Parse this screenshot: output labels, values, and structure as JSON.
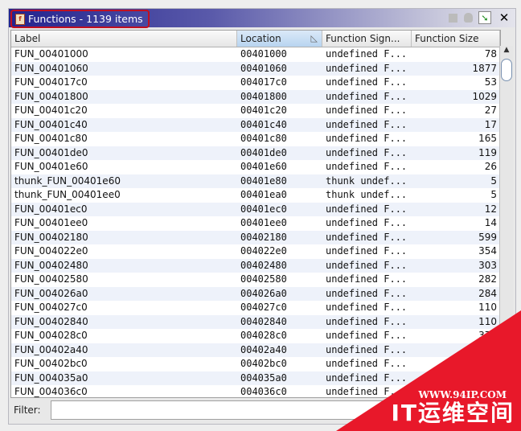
{
  "window": {
    "title": "Functions - 1139 items"
  },
  "columns": [
    "Label",
    "Location",
    "Function Sign...",
    "Function Size"
  ],
  "sorted_column": "Location",
  "rows": [
    [
      "FUN_00401000",
      "00401000",
      "undefined F...",
      "78"
    ],
    [
      "FUN_00401060",
      "00401060",
      "undefined F...",
      "1877"
    ],
    [
      "FUN_004017c0",
      "004017c0",
      "undefined F...",
      "53"
    ],
    [
      "FUN_00401800",
      "00401800",
      "undefined F...",
      "1029"
    ],
    [
      "FUN_00401c20",
      "00401c20",
      "undefined F...",
      "27"
    ],
    [
      "FUN_00401c40",
      "00401c40",
      "undefined F...",
      "17"
    ],
    [
      "FUN_00401c80",
      "00401c80",
      "undefined F...",
      "165"
    ],
    [
      "FUN_00401de0",
      "00401de0",
      "undefined F...",
      "119"
    ],
    [
      "FUN_00401e60",
      "00401e60",
      "undefined F...",
      "26"
    ],
    [
      "thunk_FUN_00401e60",
      "00401e80",
      "thunk undef...",
      "5"
    ],
    [
      "thunk_FUN_00401ee0",
      "00401ea0",
      "thunk undef...",
      "5"
    ],
    [
      "FUN_00401ec0",
      "00401ec0",
      "undefined F...",
      "12"
    ],
    [
      "FUN_00401ee0",
      "00401ee0",
      "undefined F...",
      "14"
    ],
    [
      "FUN_00402180",
      "00402180",
      "undefined F...",
      "599"
    ],
    [
      "FUN_004022e0",
      "004022e0",
      "undefined F...",
      "354"
    ],
    [
      "FUN_00402480",
      "00402480",
      "undefined F...",
      "303"
    ],
    [
      "FUN_00402580",
      "00402580",
      "undefined F...",
      "282"
    ],
    [
      "FUN_004026a0",
      "004026a0",
      "undefined F...",
      "284"
    ],
    [
      "FUN_004027c0",
      "004027c0",
      "undefined F...",
      "110"
    ],
    [
      "FUN_00402840",
      "00402840",
      "undefined F...",
      "110"
    ],
    [
      "FUN_004028c0",
      "004028c0",
      "undefined F...",
      "376"
    ],
    [
      "FUN_00402a40",
      "00402a40",
      "undefined F...",
      "368"
    ],
    [
      "FUN_00402bc0",
      "00402bc0",
      "undefined F...",
      ""
    ],
    [
      "FUN_004035a0",
      "004035a0",
      "undefined F...",
      ""
    ],
    [
      "FUN_004036c0",
      "004036c0",
      "undefined F...",
      ""
    ]
  ],
  "filter": {
    "label": "Filter:",
    "value": ""
  },
  "watermark": {
    "url": "WWW.94IP.COM",
    "name": "IT运维空间"
  }
}
